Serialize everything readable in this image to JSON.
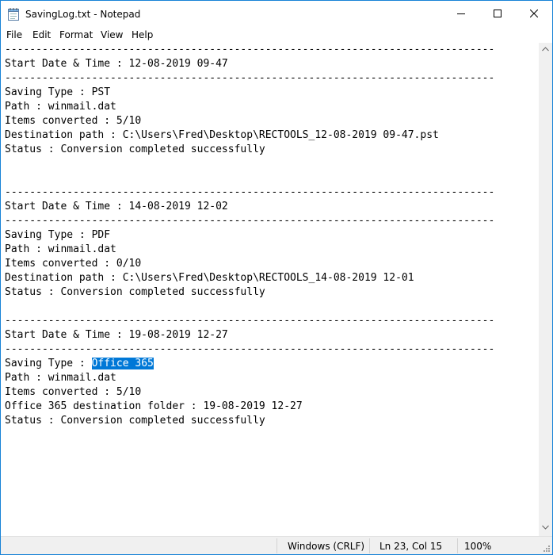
{
  "window": {
    "title": "SavingLog.txt - Notepad"
  },
  "menu": [
    "File",
    "Edit",
    "Format",
    "View",
    "Help"
  ],
  "editor": {
    "lines": [
      "-------------------------------------------------------------------------------",
      "Start Date & Time : 12-08-2019 09-47",
      "-------------------------------------------------------------------------------",
      "Saving Type : PST",
      "Path : winmail.dat",
      "Items converted : 5/10",
      "Destination path : C:\\Users\\Fred\\Desktop\\RECTOOLS_12-08-2019 09-47.pst",
      "Status : Conversion completed successfully",
      "",
      "",
      "-------------------------------------------------------------------------------",
      "Start Date & Time : 14-08-2019 12-02",
      "-------------------------------------------------------------------------------",
      "Saving Type : PDF",
      "Path : winmail.dat",
      "Items converted : 0/10",
      "Destination path : C:\\Users\\Fred\\Desktop\\RECTOOLS_14-08-2019 12-01",
      "Status : Conversion completed successfully",
      "",
      "-------------------------------------------------------------------------------",
      "Start Date & Time : 19-08-2019 12-27",
      "-------------------------------------------------------------------------------",
      "Saving Type : ",
      "Path : winmail.dat",
      "Items converted : 5/10",
      "Office 365 destination folder : 19-08-2019 12-27",
      "Status : Conversion completed successfully"
    ],
    "selected_text": "Office 365",
    "selected_line_index": 22
  },
  "status": {
    "encoding": "Windows (CRLF)",
    "position": "Ln 23, Col 15",
    "zoom": "100%"
  },
  "colors": {
    "selection": "#0078d7",
    "border": "#1883d7"
  }
}
